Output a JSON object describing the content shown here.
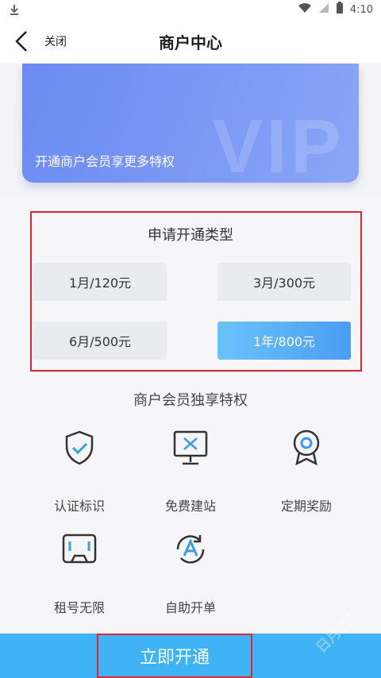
{
  "status_bar": {
    "time": "4:10"
  },
  "nav": {
    "close_label": "关闭",
    "title": "商户中心"
  },
  "vip_card": {
    "background_text": "VIP",
    "description": "开通商户会员享更多特权"
  },
  "plans": {
    "title": "申请开通类型",
    "options": [
      {
        "label": "1月/120元",
        "selected": false
      },
      {
        "label": "3月/300元",
        "selected": false
      },
      {
        "label": "6月/500元",
        "selected": false
      },
      {
        "label": "1年/800元",
        "selected": true
      }
    ]
  },
  "perks": {
    "title": "商户会员独享特权",
    "items": [
      {
        "label": "认证标识",
        "icon": "shield-check-icon"
      },
      {
        "label": "免费建站",
        "icon": "monitor-tools-icon"
      },
      {
        "label": "定期奖励",
        "icon": "medal-icon"
      },
      {
        "label": "租号无限",
        "icon": "vr-headset-icon"
      },
      {
        "label": "自助开单",
        "icon": "auto-a-icon"
      }
    ]
  },
  "cta": {
    "label": "立即开通"
  },
  "watermark": "日月在线",
  "colors": {
    "accent": "#3fb3f6",
    "selected_plan": "#4a9df2",
    "vip_card": "#7d9af5",
    "highlight_border": "#e0262f"
  }
}
